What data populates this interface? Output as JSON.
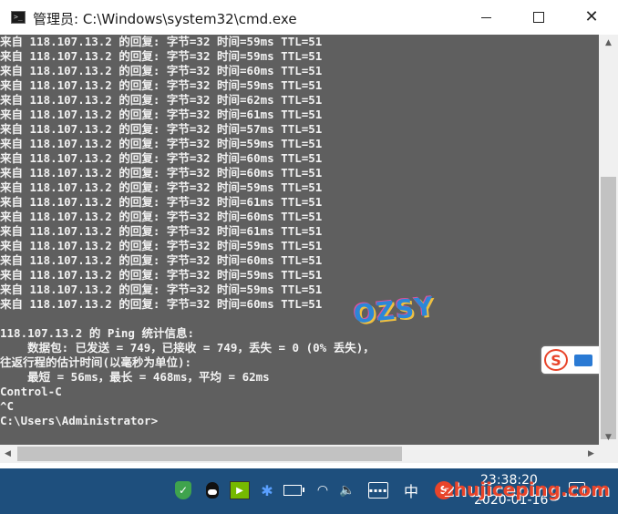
{
  "window": {
    "title": "管理员: C:\\Windows\\system32\\cmd.exe",
    "minimize_glyph": "",
    "close_glyph": "✕"
  },
  "console": {
    "reply_lines": [
      "来自 118.107.13.2 的回复: 字节=32 时间=59ms TTL=51",
      "来自 118.107.13.2 的回复: 字节=32 时间=59ms TTL=51",
      "来自 118.107.13.2 的回复: 字节=32 时间=60ms TTL=51",
      "来自 118.107.13.2 的回复: 字节=32 时间=59ms TTL=51",
      "来自 118.107.13.2 的回复: 字节=32 时间=62ms TTL=51",
      "来自 118.107.13.2 的回复: 字节=32 时间=61ms TTL=51",
      "来自 118.107.13.2 的回复: 字节=32 时间=57ms TTL=51",
      "来自 118.107.13.2 的回复: 字节=32 时间=59ms TTL=51",
      "来自 118.107.13.2 的回复: 字节=32 时间=60ms TTL=51",
      "来自 118.107.13.2 的回复: 字节=32 时间=60ms TTL=51",
      "来自 118.107.13.2 的回复: 字节=32 时间=59ms TTL=51",
      "来自 118.107.13.2 的回复: 字节=32 时间=61ms TTL=51",
      "来自 118.107.13.2 的回复: 字节=32 时间=60ms TTL=51",
      "来自 118.107.13.2 的回复: 字节=32 时间=61ms TTL=51",
      "来自 118.107.13.2 的回复: 字节=32 时间=59ms TTL=51",
      "来自 118.107.13.2 的回复: 字节=32 时间=60ms TTL=51",
      "来自 118.107.13.2 的回复: 字节=32 时间=59ms TTL=51",
      "来自 118.107.13.2 的回复: 字节=32 时间=59ms TTL=51",
      "来自 118.107.13.2 的回复: 字节=32 时间=60ms TTL=51"
    ],
    "stats_header": "118.107.13.2 的 Ping 统计信息:",
    "packets": "    数据包: 已发送 = 749，已接收 = 749，丢失 = 0 (0% 丢失)，",
    "rtt_header": "往返行程的估计时间(以毫秒为单位):",
    "rtt_values": "    最短 = 56ms，最长 = 468ms，平均 = 62ms",
    "ctrl_c": "Control-C",
    "caret_c": "^C",
    "prompt": "C:\\Users\\Administrator>"
  },
  "scrollbars": {
    "up_arrow": "▲",
    "down_arrow": "▼",
    "left_arrow": "◀",
    "right_arrow": "▶"
  },
  "watermarks": {
    "logo_text": "OZSY",
    "site_text": "zhujiceping.com"
  },
  "ime": {
    "logo_letter": "S",
    "tool_glyph": "🔧"
  },
  "taskbar": {
    "shield_glyph": "✓",
    "nvidia_glyph": "▶",
    "bluetooth_glyph": "✱",
    "wifi_glyph": "◠",
    "volume_glyph": "🔈",
    "keyboard_glyph": "▪▪▪▪",
    "ime_mode": "中",
    "sogou_letter": "S",
    "time": "23:38:20",
    "date": "2020-01-16"
  },
  "colors": {
    "console_bg": "#5f5f5f",
    "console_text": "#f2f2f2",
    "taskbar_bg": "#1e4f7d"
  }
}
